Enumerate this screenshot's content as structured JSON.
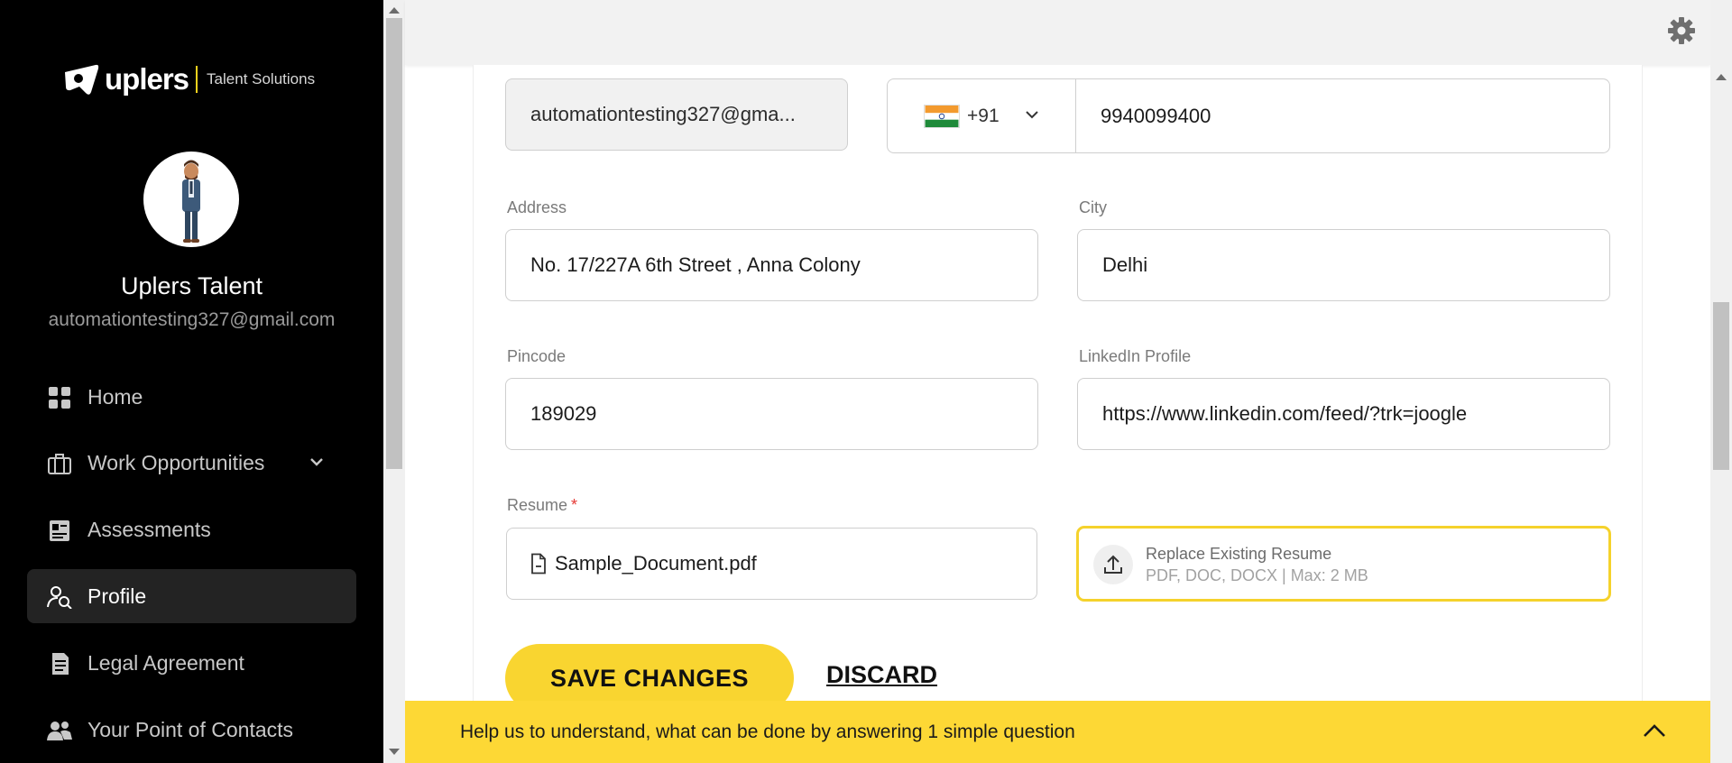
{
  "sidebar": {
    "logo": {
      "brand": "uplers",
      "tagline": "Talent Solutions"
    },
    "profile": {
      "name": "Uplers Talent",
      "email": "automationtesting327@gmail.com"
    },
    "nav": [
      {
        "label": "Home",
        "icon": "grid-icon",
        "active": false
      },
      {
        "label": "Work Opportunities",
        "icon": "briefcase-icon",
        "active": false,
        "has_dropdown": true
      },
      {
        "label": "Assessments",
        "icon": "assessment-icon",
        "active": false
      },
      {
        "label": "Profile",
        "icon": "user-search-icon",
        "active": true
      },
      {
        "label": "Legal Agreement",
        "icon": "document-icon",
        "active": false
      },
      {
        "label": "Your Point of Contacts",
        "icon": "contacts-icon",
        "active": false
      }
    ]
  },
  "topbar": {
    "settings_icon": "gear-icon"
  },
  "form": {
    "email": {
      "value": "automationtesting327@gma..."
    },
    "phone": {
      "country_code": "+91",
      "country_flag": "india-flag",
      "number": "9940099400"
    },
    "address": {
      "label": "Address",
      "value": "No. 17/227A 6th Street , Anna Colony"
    },
    "city": {
      "label": "City",
      "value": "Delhi"
    },
    "pincode": {
      "label": "Pincode",
      "value": "189029"
    },
    "linkedin": {
      "label": "LinkedIn Profile",
      "value": "https://www.linkedin.com/feed/?trk=joogle"
    },
    "resume": {
      "label": "Resume",
      "required_mark": "*",
      "file_name": "Sample_Document.pdf",
      "upload_title": "Replace Existing Resume",
      "upload_hint": "PDF, DOC, DOCX | Max: 2 MB"
    },
    "actions": {
      "save_label": "SAVE CHANGES",
      "discard_label": "DISCARD"
    }
  },
  "feedback": {
    "text": "Help us to understand, what can be done by answering 1 simple question"
  },
  "colors": {
    "accent": "#fdd835",
    "sidebar_bg": "#000000",
    "active_nav": "#232323",
    "required": "#e53935"
  }
}
